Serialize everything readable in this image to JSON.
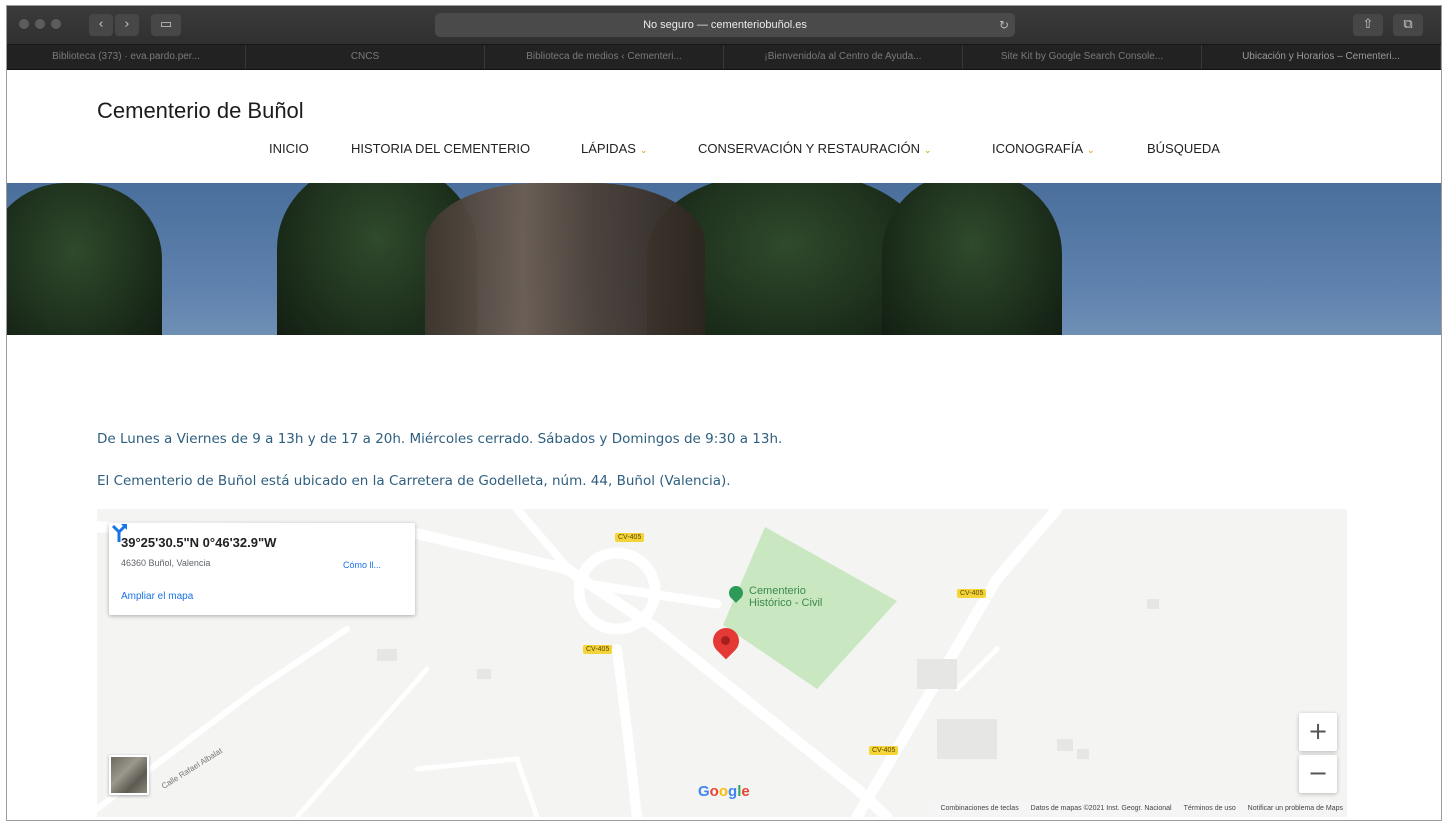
{
  "browser": {
    "address": "No seguro — cementeriobuñol.es",
    "tabs": [
      "Biblioteca (373) · eva.pardo.per...",
      "CNCS",
      "Biblioteca de medios ‹ Cementeri...",
      "¡Bienvenido/a al Centro de Ayuda...",
      "Site Kit by Google Search Console...",
      "Ubicación y Horarios – Cementeri..."
    ],
    "back_icon": "‹",
    "forward_icon": "›",
    "sidebar_icon": "▭",
    "reload_icon": "↻",
    "share_icon": "⇧",
    "tabs_icon": "⧉"
  },
  "site": {
    "title": "Cementerio de Buñol",
    "menu": [
      {
        "label": "INICIO",
        "dropdown": false
      },
      {
        "label": "HISTORIA DEL CEMENTERIO",
        "dropdown": false
      },
      {
        "label": "LÁPIDAS",
        "dropdown": true
      },
      {
        "label": "CONSERVACIÓN Y RESTAURACIÓN",
        "dropdown": true
      },
      {
        "label": "ICONOGRAFÍA",
        "dropdown": true
      },
      {
        "label": "BÚSQUEDA",
        "dropdown": false
      }
    ],
    "caret_glyph": "⌄",
    "accent_color": "#d7a100"
  },
  "content": {
    "hours": "De Lunes a Viernes de 9 a 13h y de 17 a 20h. Miércoles cerrado. Sábados y Domingos de 9:30 a 13h.",
    "location": "El Cementerio de Buñol está ubicado en la Carretera de Godelleta, núm. 44, Buñol (Valencia).",
    "text_color": "#2f5f7f"
  },
  "map": {
    "coords": "39°25'30.5\"N 0°46'32.9\"W",
    "address": "46360 Buñol, Valencia",
    "enlarge_label": "Ampliar el mapa",
    "directions_label": "Cómo ll...",
    "place_name_line1": "Cementerio",
    "place_name_line2": "Histórico - Civil",
    "road_label": "CV-405",
    "street_label": "Calle Rafael Albalat",
    "zoom_in": "+",
    "zoom_out": "−",
    "google": [
      "G",
      "o",
      "o",
      "g",
      "l",
      "e"
    ],
    "attribution": [
      "Combinaciones de teclas",
      "Datos de mapas ©2021 Inst. Geogr. Nacional",
      "Términos de uso",
      "Notificar un problema de Maps"
    ],
    "marker_color": "#e53935",
    "park_color": "#c9e8c1"
  }
}
